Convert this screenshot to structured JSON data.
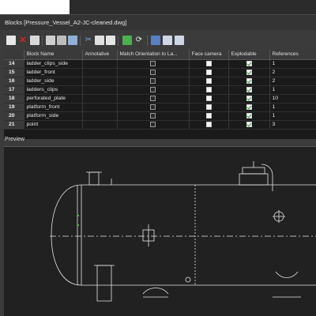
{
  "window": {
    "title": "Blocks [Pressure_Vessel_A2-JC-cleaned.dwg]"
  },
  "toolbar": {
    "icons": [
      "new-block-icon",
      "delete-icon",
      "rename-icon",
      "insert-icon",
      "wblock-icon",
      "redefine-icon",
      "cut-icon",
      "copy-icon",
      "paste-icon",
      "properties-icon",
      "refresh-icon",
      "grid-view-icon",
      "list-view-icon",
      "details-view-icon"
    ]
  },
  "table": {
    "columns": [
      "",
      "Block Name",
      "Annotative",
      "Match Orientation to La...",
      "Face camera",
      "Explodable",
      "References"
    ],
    "rows": [
      {
        "num": "14",
        "name": "ladder_clips_side",
        "face_camera": true,
        "explodable": true,
        "references": "1"
      },
      {
        "num": "15",
        "name": "ladder_front",
        "face_camera": true,
        "explodable": true,
        "references": "2"
      },
      {
        "num": "16",
        "name": "ladder_side",
        "face_camera": true,
        "explodable": true,
        "references": "2"
      },
      {
        "num": "17",
        "name": "ladders_clips",
        "face_camera": true,
        "explodable": true,
        "references": "1"
      },
      {
        "num": "18",
        "name": "perforated_plate",
        "face_camera": true,
        "explodable": true,
        "references": "10"
      },
      {
        "num": "19",
        "name": "platform_front",
        "face_camera": true,
        "explodable": true,
        "references": "1"
      },
      {
        "num": "20",
        "name": "platform_side",
        "face_camera": true,
        "explodable": true,
        "references": "1"
      },
      {
        "num": "21",
        "name": "point",
        "face_camera": true,
        "explodable": true,
        "references": "3"
      }
    ]
  },
  "preview": {
    "label": "Preview"
  },
  "colors": {
    "background": "#3b3b3b",
    "grid": "#1a1a1a",
    "preview": "#212121",
    "check": "#2a9a2a"
  }
}
